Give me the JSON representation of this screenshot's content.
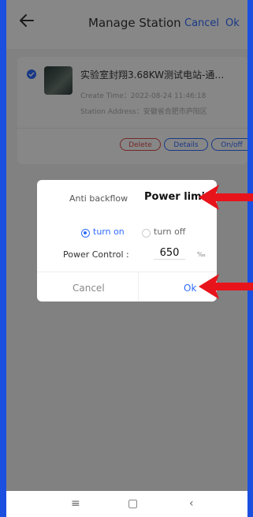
{
  "header": {
    "title": "Manage Station",
    "cancel_label": "Cancel",
    "ok_label": "Ok"
  },
  "station": {
    "name": "实验室封翔3.68KW测试电站-通…",
    "create_time": "Create Time：2022-08-24 11:46:18",
    "address": "Station Address：安徽省合肥市庐阳区",
    "actions": {
      "delete": "Delete",
      "details": "Details",
      "onoff": "On/off"
    },
    "selected": true
  },
  "dialog": {
    "anti_backflow_label": "Anti backflow",
    "power_limit_label": "Power limit",
    "option_on": "turn on",
    "option_off": "turn off",
    "selected_option": "turn on",
    "power_control_label": "Power Control :",
    "power_control_value": "650",
    "power_control_unit": "‰",
    "cancel_label": "Cancel",
    "ok_label": "Ok"
  },
  "navbar": {
    "menu_icon": "≡",
    "home_icon": "▢",
    "back_icon": "‹"
  },
  "colors": {
    "accent": "#2f6bff",
    "danger": "#e04a4a",
    "annotation_arrow": "#e8141c",
    "outer_border": "#1a4fe0"
  }
}
